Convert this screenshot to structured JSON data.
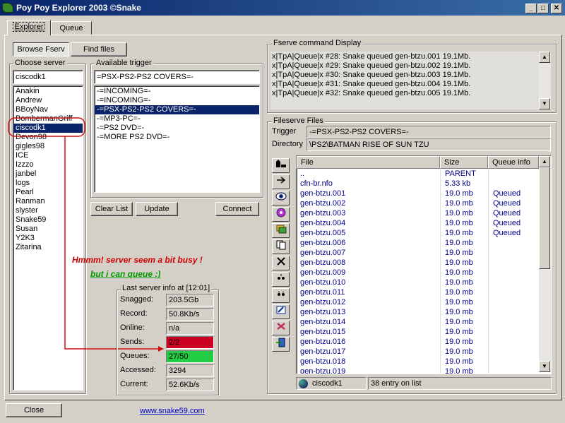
{
  "window": {
    "title": "Poy Poy Explorer 2003 ©Snake"
  },
  "tabs": [
    {
      "label": "Explorer"
    },
    {
      "label": "Queue"
    }
  ],
  "buttons": {
    "browse": "Browse Fserv",
    "find": "Find files",
    "clear": "Clear List",
    "update": "Update",
    "connect": "Connect",
    "close": "Close"
  },
  "choose_server": {
    "label": "Choose server",
    "value": "ciscodk1",
    "items": [
      "Anakin",
      "Andrew",
      "BBoyNav",
      "BombermanGriff",
      "ciscodk1",
      "Devon98",
      "gigles98",
      "ICE",
      "Izzzo",
      "janbel",
      "logs",
      "Pearl",
      "Ranman",
      "slyster",
      "Snake59",
      "Susan",
      "Y2K3",
      "Zitarina"
    ],
    "selected_index": 4
  },
  "trigger": {
    "label": "Available trigger",
    "value": "=PSX-PS2-PS2 COVERS=-",
    "items": [
      "-=INCOMING=-",
      "-=INCOMING=-",
      "-=PSX-PS2-PS2 COVERS=-",
      "-=MP3-PC=-",
      "-=PS2 DVD=-",
      "-=MORE PS2 DVD=-"
    ],
    "selected_index": 2
  },
  "annotations": {
    "busy": "Hmmm! server seem a bit busy !",
    "queue": "but i can queue  :)"
  },
  "server_info": {
    "label": "Last server info at [12:01]",
    "rows": [
      {
        "label": "Snagged:",
        "value": "203.5Gb"
      },
      {
        "label": "Record:",
        "value": "50.8Kb/s"
      },
      {
        "label": "Online:",
        "value": "n/a"
      },
      {
        "label": "Sends:",
        "value": "2/2"
      },
      {
        "label": "Queues:",
        "value": "27/50"
      },
      {
        "label": "Accessed:",
        "value": "3294"
      },
      {
        "label": "Current:",
        "value": "52.6Kb/s"
      }
    ],
    "sends_color": "#cc0022",
    "queues_color": "#22cc44"
  },
  "fserve_display": {
    "label": "Fserve command Display",
    "lines": [
      "x|TpA|Queue|x #28: Snake queued gen-btzu.001 19.1Mb.",
      "x|TpA|Queue|x #29: Snake queued gen-btzu.002 19.1Mb.",
      "x|TpA|Queue|x #30: Snake queued gen-btzu.003 19.1Mb.",
      "x|TpA|Queue|x #31: Snake queued gen-btzu.004 19.1Mb.",
      "x|TpA|Queue|x #32: Snake queued gen-btzu.005 19.1Mb."
    ]
  },
  "fileserve": {
    "label": "Fileserve Files",
    "trigger_label": "Trigger",
    "trigger_value": "-=PSX-PS2-PS2 COVERS=-",
    "directory_label": "Directory",
    "directory_value": "\\PS2\\BATMAN RISE OF SUN TZU",
    "columns": [
      "File",
      "Size",
      "Queue info"
    ],
    "rows": [
      {
        "file": "..",
        "size": "PARENT",
        "queue": ""
      },
      {
        "file": "cfn-br.nfo",
        "size": "5.33 kb",
        "queue": ""
      },
      {
        "file": "gen-btzu.001",
        "size": "19.0 mb",
        "queue": "Queued"
      },
      {
        "file": "gen-btzu.002",
        "size": "19.0 mb",
        "queue": "Queued"
      },
      {
        "file": "gen-btzu.003",
        "size": "19.0 mb",
        "queue": "Queued"
      },
      {
        "file": "gen-btzu.004",
        "size": "19.0 mb",
        "queue": "Queued"
      },
      {
        "file": "gen-btzu.005",
        "size": "19.0 mb",
        "queue": "Queued"
      },
      {
        "file": "gen-btzu.006",
        "size": "19.0 mb",
        "queue": ""
      },
      {
        "file": "gen-btzu.007",
        "size": "19.0 mb",
        "queue": ""
      },
      {
        "file": "gen-btzu.008",
        "size": "19.0 mb",
        "queue": ""
      },
      {
        "file": "gen-btzu.009",
        "size": "19.0 mb",
        "queue": ""
      },
      {
        "file": "gen-btzu.010",
        "size": "19.0 mb",
        "queue": ""
      },
      {
        "file": "gen-btzu.011",
        "size": "19.0 mb",
        "queue": ""
      },
      {
        "file": "gen-btzu.012",
        "size": "19.0 mb",
        "queue": ""
      },
      {
        "file": "gen-btzu.013",
        "size": "19.0 mb",
        "queue": ""
      },
      {
        "file": "gen-btzu.014",
        "size": "19.0 mb",
        "queue": ""
      },
      {
        "file": "gen-btzu.015",
        "size": "19.0 mb",
        "queue": ""
      },
      {
        "file": "gen-btzu.016",
        "size": "19.0 mb",
        "queue": ""
      },
      {
        "file": "gen-btzu.017",
        "size": "19.0 mb",
        "queue": ""
      },
      {
        "file": "gen-btzu.018",
        "size": "19.0 mb",
        "queue": ""
      },
      {
        "file": "gen-btzu.019",
        "size": "19.0 mb",
        "queue": ""
      }
    ],
    "status_server": "ciscodk1",
    "status_count": "38 entry on list"
  },
  "footer_link": "www.snake59.com",
  "colors": {
    "title_bar": "#0a246a",
    "selection": "#0a246a",
    "annotation_red": "#cc0000",
    "annotation_green": "#009900",
    "file_text": "#00008b"
  },
  "toolbar_icons": [
    "parent-folder-icon",
    "go-arrow-icon",
    "view-eye-icon",
    "play-disc-icon",
    "queue-files-icon",
    "copy-icon",
    "delete-icon",
    "stars-icon",
    "stars-small-icon",
    "edit-icon",
    "tools-icon",
    "exit-icon"
  ]
}
